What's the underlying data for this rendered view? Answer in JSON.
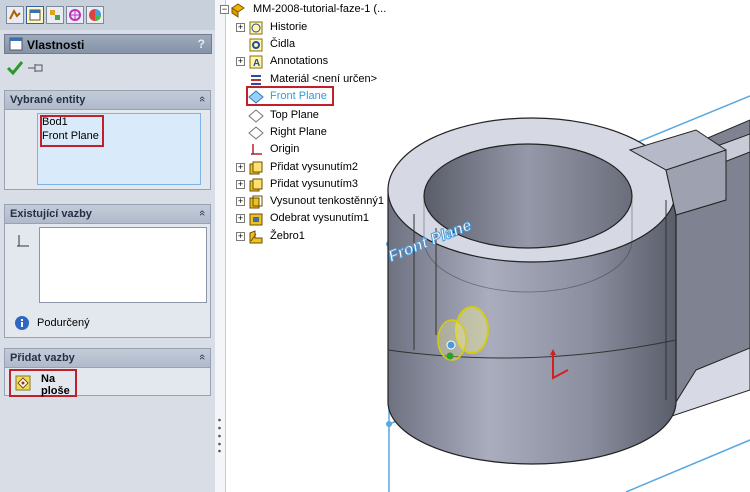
{
  "property_manager": {
    "title": "Vlastnosti",
    "help": "?",
    "groups": {
      "selected_entities": {
        "title": "Vybrané entity",
        "collapse": "«",
        "items": [
          "Bod1",
          "Front Plane"
        ]
      },
      "existing_relations": {
        "title": "Existující vazby",
        "collapse": "«",
        "status": "Podurčený"
      },
      "add_relations": {
        "title": "Přidat vazby",
        "collapse": "«",
        "option_line1": "Na",
        "option_line2": "ploše"
      }
    }
  },
  "tree": {
    "root": "MM-2008-tutorial-faze-1  (...",
    "items": [
      {
        "label": "Historie",
        "expander": "+"
      },
      {
        "label": "Čidla",
        "expander": ""
      },
      {
        "label": "Annotations",
        "expander": "+"
      },
      {
        "label": "Materiál <není určen>",
        "expander": ""
      },
      {
        "label": "Front Plane",
        "expander": ""
      },
      {
        "label": "Top Plane",
        "expander": ""
      },
      {
        "label": "Right Plane",
        "expander": ""
      },
      {
        "label": "Origin",
        "expander": ""
      },
      {
        "label": "Přidat vysunutím2",
        "expander": "+"
      },
      {
        "label": "Přidat vysunutím3",
        "expander": "+"
      },
      {
        "label": "Vysunout tenkostěnný1",
        "expander": "+"
      },
      {
        "label": "Odebrat vysunutím1",
        "expander": "+"
      },
      {
        "label": "Žebro1",
        "expander": "+"
      }
    ]
  },
  "viewport": {
    "plane_label": "Front Plane"
  },
  "colors": {
    "selection": "#2aa0d8",
    "highlight_box": "#c0202a",
    "panel": "#d8dde6"
  }
}
